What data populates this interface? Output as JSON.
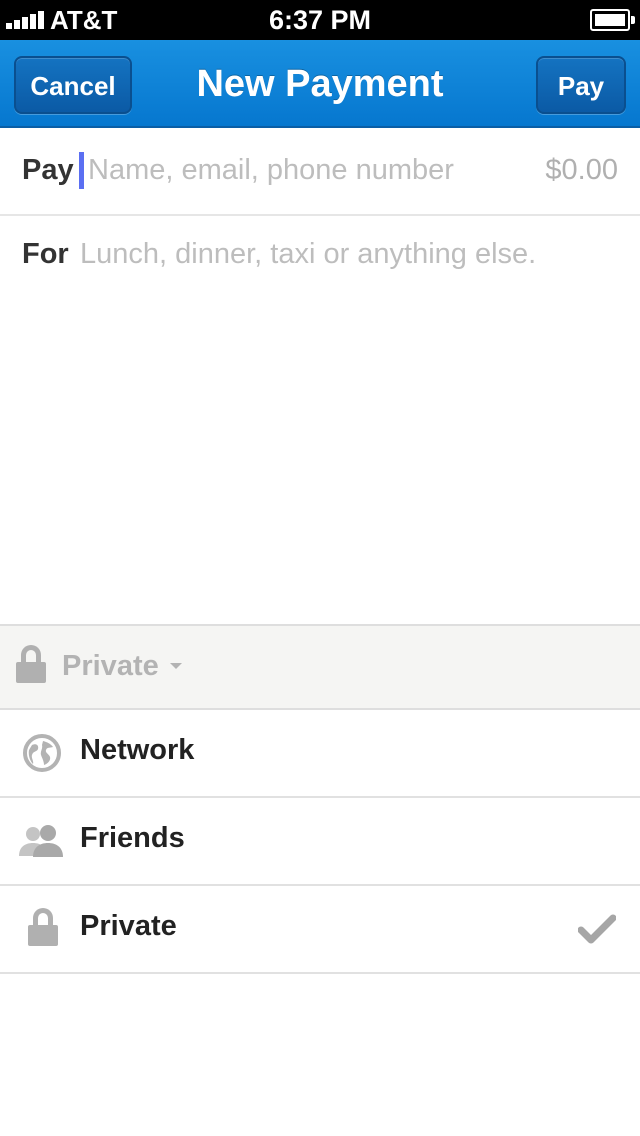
{
  "status_bar": {
    "carrier": "AT&T",
    "time": "6:37 PM",
    "signal_bars": 5
  },
  "nav": {
    "title": "New Payment",
    "cancel_label": "Cancel",
    "pay_label": "Pay",
    "color": "#0a7fd6"
  },
  "form": {
    "pay_label": "Pay",
    "pay_placeholder": "Name, email, phone number",
    "amount": "$0.00",
    "for_label": "For",
    "for_placeholder": "Lunch, dinner, taxi or anything else."
  },
  "privacy": {
    "current": "Private",
    "icon": "lock-icon",
    "options": [
      {
        "label": "Network",
        "icon": "globe-icon",
        "selected": false
      },
      {
        "label": "Friends",
        "icon": "friends-icon",
        "selected": false
      },
      {
        "label": "Private",
        "icon": "lock-icon",
        "selected": true
      }
    ]
  }
}
